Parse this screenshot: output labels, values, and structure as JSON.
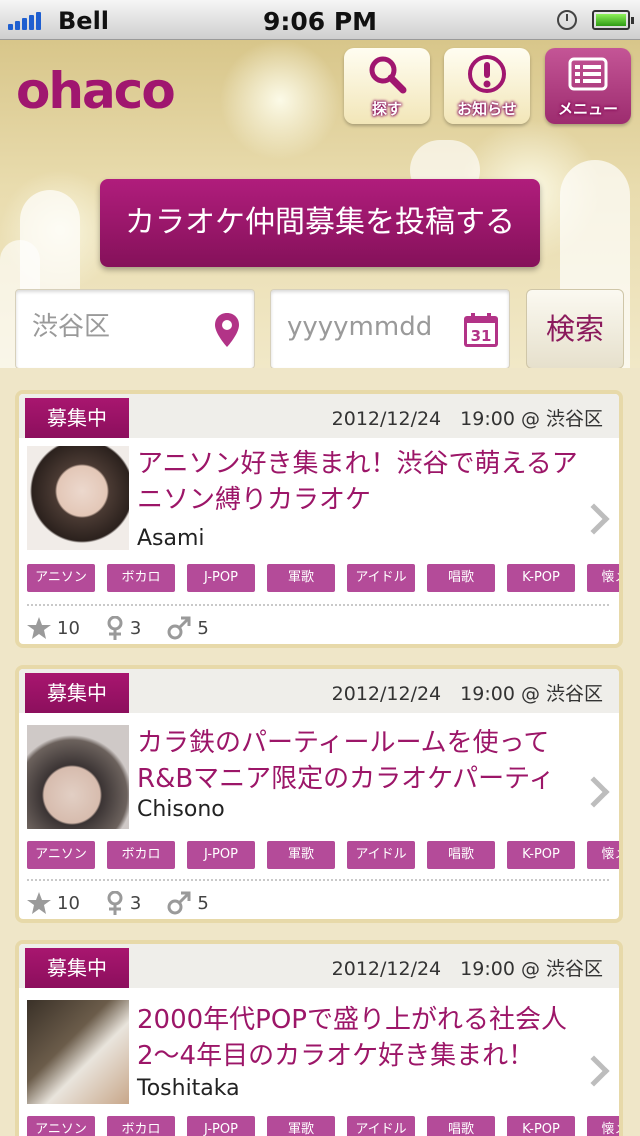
{
  "status_bar": {
    "carrier": "Bell",
    "time": "9:06 PM"
  },
  "header": {
    "logo": "ohaco",
    "buttons": [
      {
        "label": "探す",
        "icon": "magnifier-icon"
      },
      {
        "label": "お知らせ",
        "icon": "exclamation-icon"
      },
      {
        "label": "メニュー",
        "icon": "menu-list-icon"
      }
    ],
    "post_button": "カラオケ仲間募集を投稿する"
  },
  "search": {
    "location_placeholder": "渋谷区",
    "date_placeholder": "yyyymmdd",
    "search_button": "検索",
    "calendar_day": "31"
  },
  "posts": [
    {
      "status": "募集中",
      "datetime": "2012/12/24　19:00 @ 渋谷区",
      "title_lines": [
        "アニソン好き集まれ！渋谷で萌えるア",
        "ニソン縛りカラオケ"
      ],
      "user": "Asami",
      "tags": [
        "アニソン",
        "ボカロ",
        "J-POP",
        "軍歌",
        "アイドル",
        "唱歌",
        "K-POP",
        "懐メロ"
      ],
      "stars": "10",
      "female": "3",
      "male": "5"
    },
    {
      "status": "募集中",
      "datetime": "2012/12/24　19:00 @ 渋谷区",
      "title_lines": [
        "カラ鉄のパーティールームを使って",
        "R&Bマニア限定のカラオケパーティ"
      ],
      "user": "Chisono",
      "tags": [
        "アニソン",
        "ボカロ",
        "J-POP",
        "軍歌",
        "アイドル",
        "唱歌",
        "K-POP",
        "懐メロ"
      ],
      "stars": "10",
      "female": "3",
      "male": "5"
    },
    {
      "status": "募集中",
      "datetime": "2012/12/24　19:00 @ 渋谷区",
      "title_lines": [
        "2000年代POPで盛り上がれる社会人",
        "2〜4年目のカラオケ好き集まれ！"
      ],
      "user": "Toshitaka",
      "tags": [
        "アニソン",
        "ボカロ",
        "J-POP",
        "軍歌",
        "アイドル",
        "唱歌",
        "K-POP",
        "懐メロ"
      ]
    }
  ]
}
